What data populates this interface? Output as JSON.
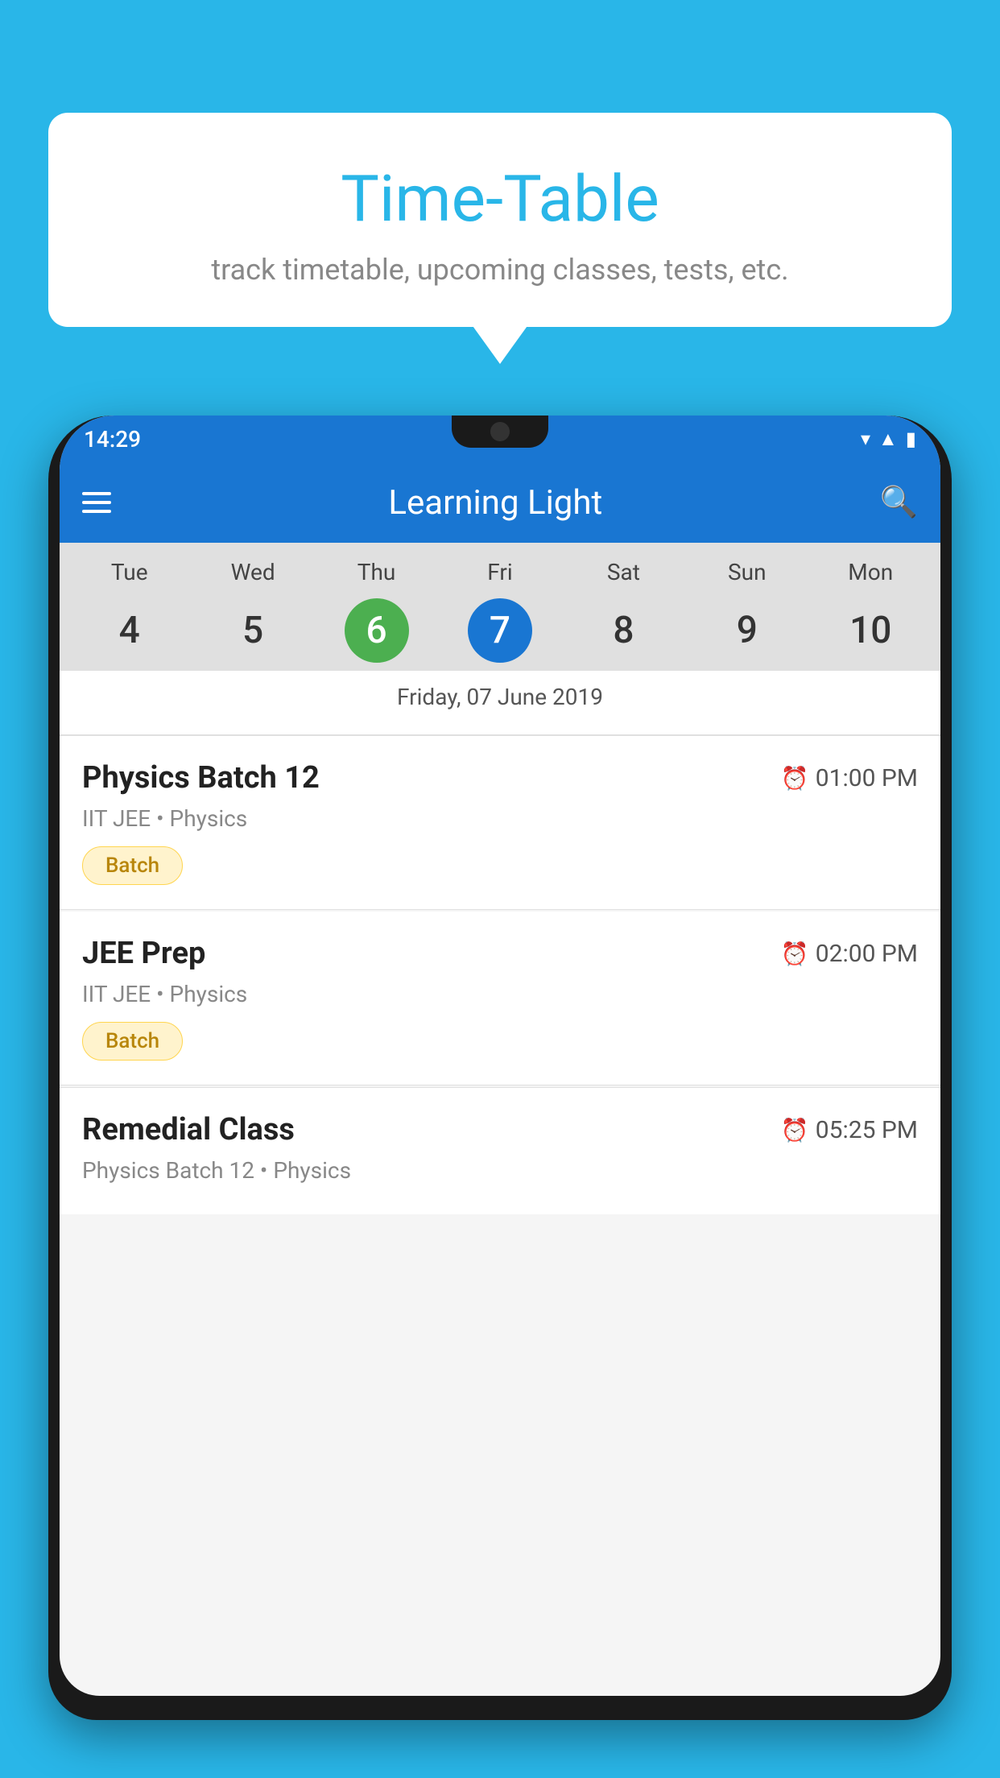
{
  "page": {
    "background_color": "#29B6E8"
  },
  "speech_bubble": {
    "title": "Time-Table",
    "subtitle": "track timetable, upcoming classes, tests, etc."
  },
  "status_bar": {
    "time": "14:29"
  },
  "app_bar": {
    "title": "Learning Light",
    "hamburger_label": "Menu",
    "search_label": "Search"
  },
  "calendar": {
    "selected_date_label": "Friday, 07 June 2019",
    "days": [
      {
        "name": "Tue",
        "number": "4",
        "state": "normal"
      },
      {
        "name": "Wed",
        "number": "5",
        "state": "normal"
      },
      {
        "name": "Thu",
        "number": "6",
        "state": "today"
      },
      {
        "name": "Fri",
        "number": "7",
        "state": "selected"
      },
      {
        "name": "Sat",
        "number": "8",
        "state": "normal"
      },
      {
        "name": "Sun",
        "number": "9",
        "state": "normal"
      },
      {
        "name": "Mon",
        "number": "10",
        "state": "normal"
      }
    ]
  },
  "events": [
    {
      "title": "Physics Batch 12",
      "time": "01:00 PM",
      "meta": "IIT JEE • Physics",
      "badge": "Batch"
    },
    {
      "title": "JEE Prep",
      "time": "02:00 PM",
      "meta": "IIT JEE • Physics",
      "badge": "Batch"
    },
    {
      "title": "Remedial Class",
      "time": "05:25 PM",
      "meta": "Physics Batch 12 • Physics",
      "badge": null
    }
  ]
}
